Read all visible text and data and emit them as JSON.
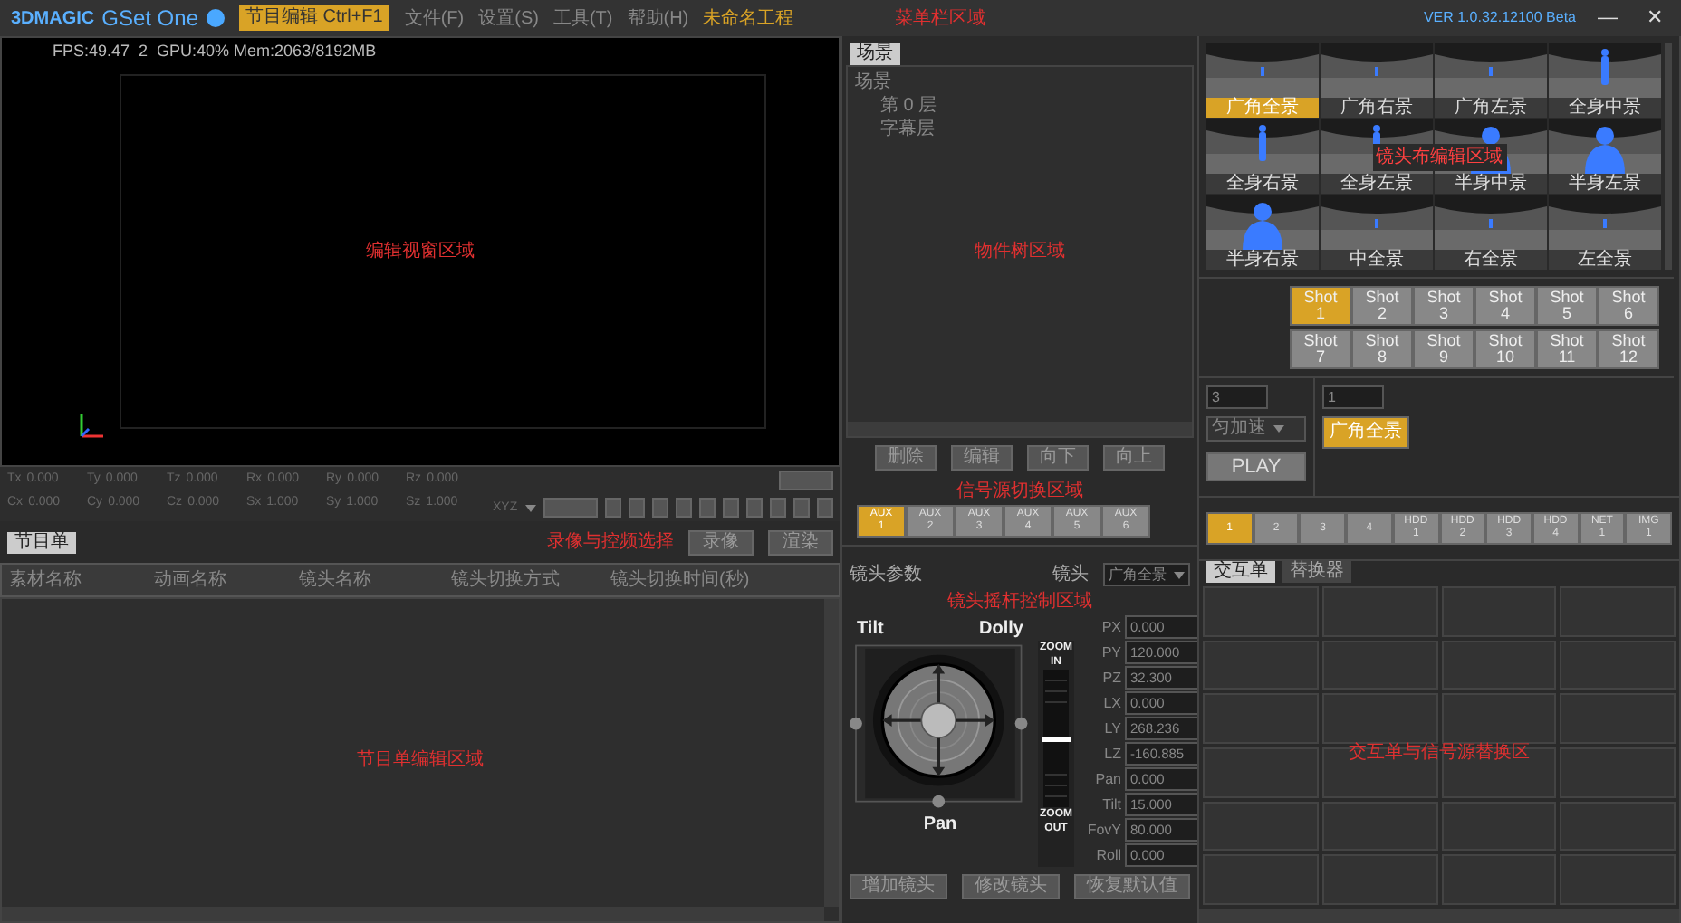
{
  "title_bar": {
    "logo": "3DMAGIC",
    "app_name": "GSet One",
    "mode_button": "节目编辑 Ctrl+F1",
    "menu": [
      "文件(F)",
      "设置(S)",
      "工具(T)",
      "帮助(H)"
    ],
    "project": "未命名工程",
    "annotation": "菜单栏区域",
    "version": "VER 1.0.32.12100 Beta",
    "minimize": "—",
    "close": "✕"
  },
  "viewport": {
    "stats": "FPS:49.47  2  GPU:40% Mem:2063/8192MB",
    "annotation": "编辑视窗区域"
  },
  "transform": {
    "fields": [
      {
        "label": "Tx",
        "value": "0.000"
      },
      {
        "label": "Ty",
        "value": "0.000"
      },
      {
        "label": "Tz",
        "value": "0.000"
      },
      {
        "label": "Rx",
        "value": "0.000"
      },
      {
        "label": "Ry",
        "value": "0.000"
      },
      {
        "label": "Rz",
        "value": "0.000"
      },
      {
        "label": "Cx",
        "value": "0.000"
      },
      {
        "label": "Cy",
        "value": "0.000"
      },
      {
        "label": "Cz",
        "value": "0.000"
      },
      {
        "label": "Sx",
        "value": "1.000"
      },
      {
        "label": "Sy",
        "value": "1.000"
      },
      {
        "label": "Sz",
        "value": "1.000"
      }
    ],
    "axis_select": "XYZ"
  },
  "playlist": {
    "tabs": [
      {
        "label": "节目单",
        "selected": true
      }
    ],
    "annotation": "录像与控频选择",
    "buttons": [
      "录像",
      "渲染"
    ],
    "columns": [
      "素材名称",
      "动画名称",
      "镜头名称",
      "镜头切换方式",
      "镜头切换时间(秒)"
    ],
    "body_annotation": "节目单编辑区域"
  },
  "scene": {
    "tabs": [
      {
        "label": "场景",
        "selected": true
      }
    ],
    "tree": [
      {
        "label": "场景",
        "children": [
          {
            "label": "第 0 层"
          },
          {
            "label": "字幕层"
          }
        ]
      }
    ],
    "annotation": "物件树区域",
    "buttons": [
      "删除",
      "编辑",
      "向下",
      "向上"
    ]
  },
  "aux": {
    "annotation": "信号源切换区域",
    "buttons": [
      {
        "line1": "AUX",
        "line2": "1",
        "selected": true
      },
      {
        "line1": "AUX",
        "line2": "2",
        "selected": false
      },
      {
        "line1": "AUX",
        "line2": "3",
        "selected": false
      },
      {
        "line1": "AUX",
        "line2": "4",
        "selected": false
      },
      {
        "line1": "AUX",
        "line2": "5",
        "selected": false
      },
      {
        "line1": "AUX",
        "line2": "6",
        "selected": false
      }
    ]
  },
  "camera": {
    "title": "镜头参数",
    "annotation": "镜头摇杆控制区域",
    "camera_label": "镜头",
    "camera_select": "广角全景",
    "tilt": "Tilt",
    "dolly": "Dolly",
    "pan": "Pan",
    "zoom_in": [
      "ZOOM",
      "IN"
    ],
    "zoom_out": [
      "ZOOM",
      "OUT"
    ],
    "zoom": {
      "level": 0.5
    },
    "fields": [
      {
        "label": "PX",
        "value": "0.000"
      },
      {
        "label": "PY",
        "value": "120.000"
      },
      {
        "label": "PZ",
        "value": "32.300"
      },
      {
        "label": "LX",
        "value": "0.000"
      },
      {
        "label": "LY",
        "value": "268.236"
      },
      {
        "label": "LZ",
        "value": "-160.885"
      },
      {
        "label": "Pan",
        "value": "0.000"
      },
      {
        "label": "Tilt",
        "value": "15.000"
      },
      {
        "label": "FovY",
        "value": "80.000"
      },
      {
        "label": "Roll",
        "value": "0.000"
      }
    ],
    "buttons": [
      "增加镜头",
      "修改镜头"
    ],
    "reset_button": "恢复默认值"
  },
  "presets": {
    "annotation": "镜头布编辑区域",
    "items": [
      {
        "label": "广角全景",
        "kind": "wide",
        "selected": true
      },
      {
        "label": "广角右景",
        "kind": "wide",
        "selected": false
      },
      {
        "label": "广角左景",
        "kind": "wide",
        "selected": false
      },
      {
        "label": "全身中景",
        "kind": "full",
        "selected": false
      },
      {
        "label": "全身右景",
        "kind": "full",
        "selected": false
      },
      {
        "label": "全身左景",
        "kind": "full",
        "selected": false
      },
      {
        "label": "半身中景",
        "kind": "half",
        "selected": false
      },
      {
        "label": "半身左景",
        "kind": "half",
        "selected": false
      },
      {
        "label": "半身右景",
        "kind": "half",
        "selected": false
      },
      {
        "label": "中全景",
        "kind": "wide",
        "selected": false
      },
      {
        "label": "右全景",
        "kind": "wide",
        "selected": false
      },
      {
        "label": "左全景",
        "kind": "wide",
        "selected": false
      }
    ]
  },
  "shots": [
    {
      "label": "Shot",
      "number": "1",
      "selected": true
    },
    {
      "label": "Shot",
      "number": "2",
      "selected": false
    },
    {
      "label": "Shot",
      "number": "3",
      "selected": false
    },
    {
      "label": "Shot",
      "number": "4",
      "selected": false
    },
    {
      "label": "Shot",
      "number": "5",
      "selected": false
    },
    {
      "label": "Shot",
      "number": "6",
      "selected": false
    },
    {
      "label": "Shot",
      "number": "7",
      "selected": false
    },
    {
      "label": "Shot",
      "number": "8",
      "selected": false
    },
    {
      "label": "Shot",
      "number": "9",
      "selected": false
    },
    {
      "label": "Shot",
      "number": "10",
      "selected": false
    },
    {
      "label": "Shot",
      "number": "11",
      "selected": false
    },
    {
      "label": "Shot",
      "number": "12",
      "selected": false
    }
  ],
  "playback": {
    "duration": "3",
    "mode_select": "匀加速",
    "play_button": "PLAY",
    "step": "1",
    "sequence": [
      "广角全景"
    ]
  },
  "sources": [
    {
      "line1": "1",
      "selected": true
    },
    {
      "line1": "2",
      "selected": false
    },
    {
      "line1": "3",
      "selected": false
    },
    {
      "line1": "4",
      "selected": false
    },
    {
      "line1": "HDD",
      "line2": "1",
      "selected": false
    },
    {
      "line1": "HDD",
      "line2": "2",
      "selected": false
    },
    {
      "line1": "HDD",
      "line2": "3",
      "selected": false
    },
    {
      "line1": "HDD",
      "line2": "4",
      "selected": false
    },
    {
      "line1": "NET",
      "line2": "1",
      "selected": false
    },
    {
      "line1": "IMG",
      "line2": "1",
      "selected": false
    }
  ],
  "interaction": {
    "tabs": [
      {
        "label": "交互单",
        "selected": true
      },
      {
        "label": "替换器",
        "selected": false
      }
    ],
    "annotation": "交互单与信号源替换区"
  }
}
